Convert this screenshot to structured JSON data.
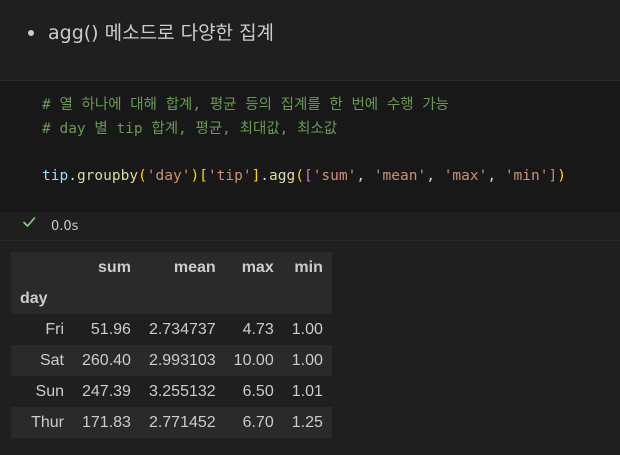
{
  "markdown": {
    "bullet_text": "agg() 메소드로 다양한 집계"
  },
  "code": {
    "comment1": "# 열 하나에 대해 합계, 평균 등의 집계를 한 번에 수행 가능",
    "comment2": "# day 별 tip 합계, 평균, 최대값, 최소값",
    "tokens": {
      "var": "tip",
      "dot1": ".",
      "fn1": "groupby",
      "p_open": "(",
      "s_day": "'day'",
      "p_close": ")",
      "b_open": "[",
      "s_tip": "'tip'",
      "b_close": "]",
      "dot2": ".",
      "fn2": "agg",
      "p2_open": "(",
      "l_open": "[",
      "s_sum": "'sum'",
      "comma1": ", ",
      "s_mean": "'mean'",
      "comma2": ", ",
      "s_max": "'max'",
      "comma3": ", ",
      "s_min": "'min'",
      "l_close": "]",
      "p2_close": ")"
    }
  },
  "status": {
    "check_icon": "check-icon",
    "exec_time": "0.0s",
    "success_color": "#89d185"
  },
  "output": {
    "columns": [
      "sum",
      "mean",
      "max",
      "min"
    ],
    "index_name": "day",
    "rows": [
      {
        "index": "Fri",
        "sum": "51.96",
        "mean": "2.734737",
        "max": "4.73",
        "min": "1.00"
      },
      {
        "index": "Sat",
        "sum": "260.40",
        "mean": "2.993103",
        "max": "10.00",
        "min": "1.00"
      },
      {
        "index": "Sun",
        "sum": "247.39",
        "mean": "3.255132",
        "max": "6.50",
        "min": "1.01"
      },
      {
        "index": "Thur",
        "sum": "171.83",
        "mean": "2.771452",
        "max": "6.70",
        "min": "1.25"
      }
    ]
  }
}
